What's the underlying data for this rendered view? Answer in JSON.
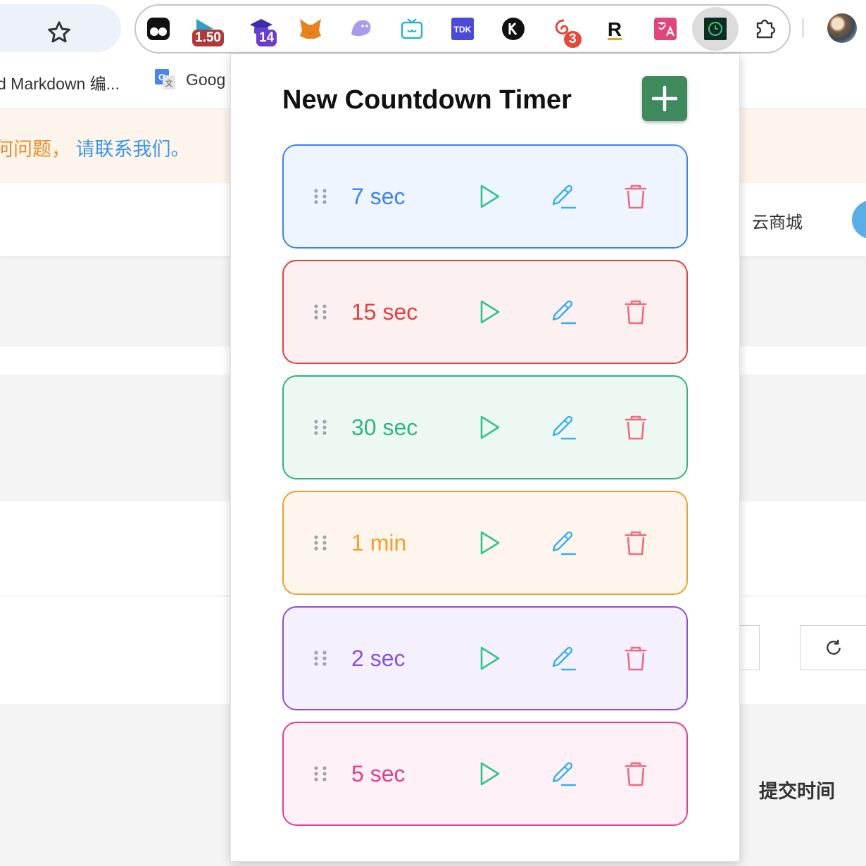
{
  "toolbar": {
    "extensions": [
      {
        "icon": "tampermonkey-icon"
      },
      {
        "icon": "video-speed-icon",
        "badge": "1.50"
      },
      {
        "icon": "graduation-cap-icon",
        "badge": "14"
      },
      {
        "icon": "metamask-fox-icon"
      },
      {
        "icon": "ghost-icon"
      },
      {
        "icon": "tv-icon"
      },
      {
        "icon": "tdk-icon",
        "text": "TDK"
      },
      {
        "icon": "k-icon"
      },
      {
        "icon": "spiral-icon",
        "badge": "3"
      },
      {
        "icon": "r-icon",
        "text": "R"
      },
      {
        "icon": "translate-icon"
      },
      {
        "icon": "countdown-timer-icon",
        "active": true
      },
      {
        "icon": "puzzle-icon"
      }
    ]
  },
  "bookmarks": {
    "items": [
      {
        "label": "d Markdown 编..."
      },
      {
        "label": "Goog"
      }
    ]
  },
  "page": {
    "banner_orange": "何问题，",
    "banner_blue": "请联系我们。",
    "nav_text": "云商城",
    "submit_time": "提交时间"
  },
  "popup": {
    "title": "New Countdown Timer",
    "add_icon": "plus-icon",
    "timers": [
      {
        "label": "7 sec",
        "color": "#3b82f6",
        "bg": "#eff5fe"
      },
      {
        "label": "15 sec",
        "color": "#e0413f",
        "bg": "#fdf0f0"
      },
      {
        "label": "30 sec",
        "color": "#2fb680",
        "bg": "#eef8f3"
      },
      {
        "label": "1 min",
        "color": "#f0a02c",
        "bg": "#fef6ec"
      },
      {
        "label": "2 sec",
        "color": "#8a4fe0",
        "bg": "#f5f0fd"
      },
      {
        "label": "5 sec",
        "color": "#e2408c",
        "bg": "#fdf0f6"
      }
    ],
    "icon_colors": {
      "play": "#2fc58a",
      "edit": "#38b0ee",
      "delete": "#f06a80",
      "handle": "#9ea4ad"
    }
  }
}
